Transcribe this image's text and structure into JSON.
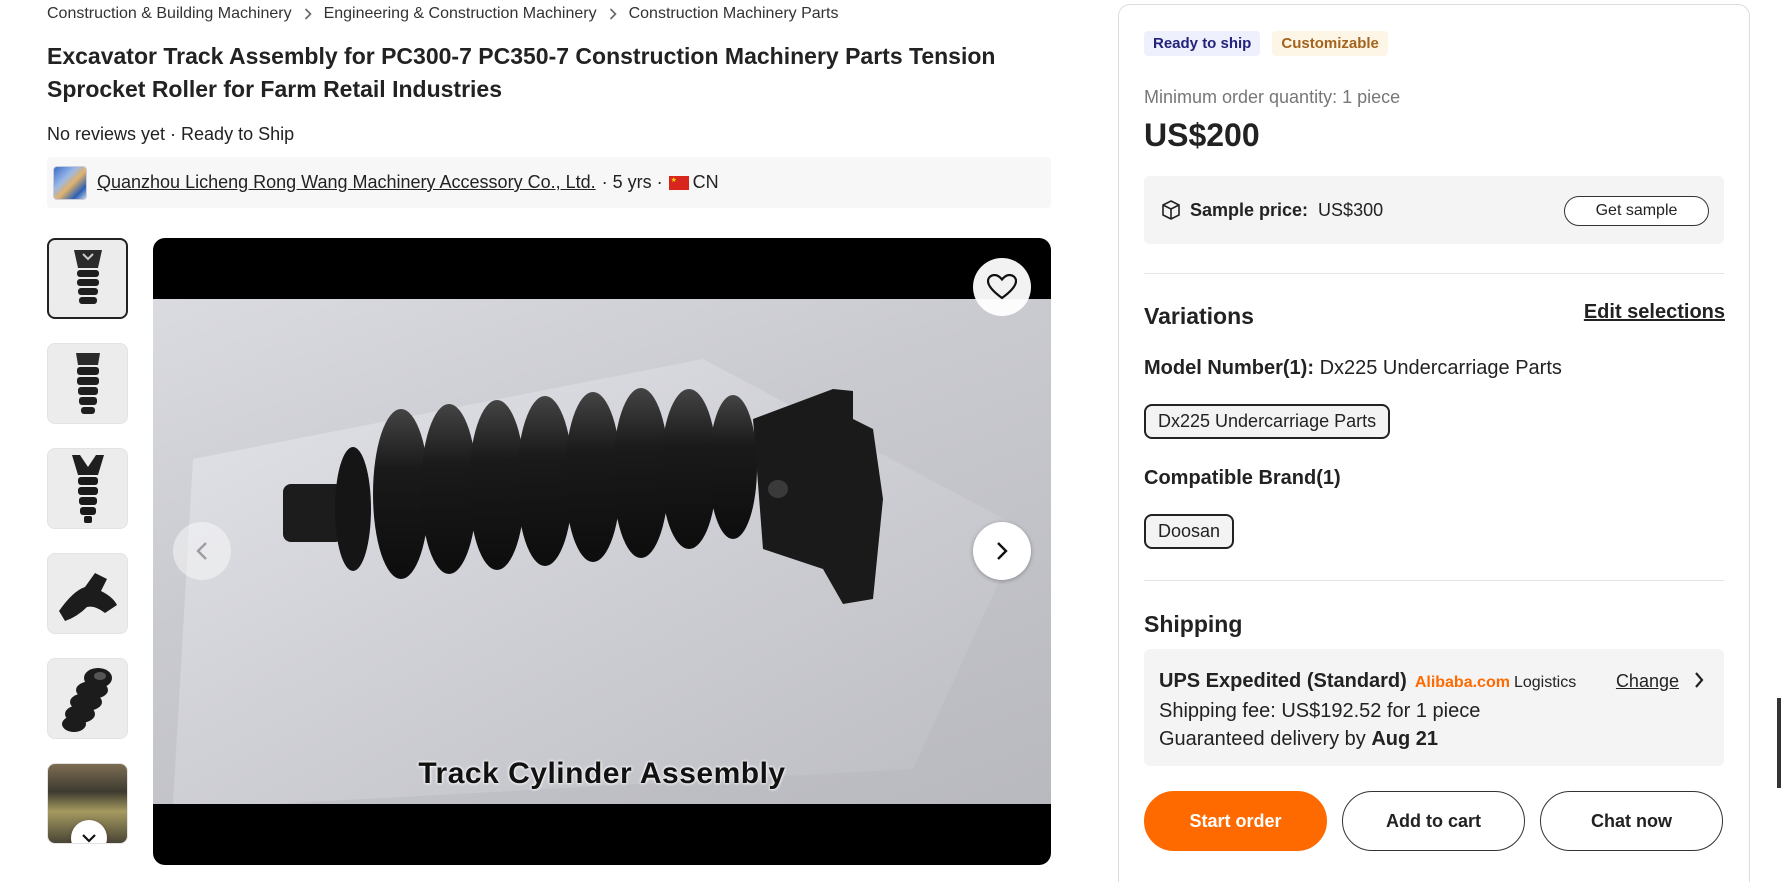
{
  "breadcrumb": {
    "items": [
      "Construction & Building Machinery",
      "Engineering & Construction Machinery",
      "Construction Machinery Parts"
    ]
  },
  "product": {
    "title": "Excavator Track Assembly for PC300-7 PC350-7 Construction Machinery Parts Tension Sprocket Roller for Farm Retail Industries",
    "reviews_status": "No reviews yet · Ready to Ship",
    "image_caption": "Track Cylinder Assembly"
  },
  "supplier": {
    "name": "Quanzhou Licheng Rong Wang Machinery Accessory Co., Ltd.",
    "years": "· 5 yrs ·",
    "country": "CN"
  },
  "icons": {
    "favorite": "heart-icon",
    "prev": "chevron-left-icon",
    "next": "chevron-right-icon",
    "thumbs_down": "chevron-down-icon",
    "sample": "box-icon"
  },
  "panel": {
    "badges": [
      "Ready to ship",
      "Customizable"
    ],
    "moq": "Minimum order quantity: 1 piece",
    "price": "US$200",
    "sample_label": "Sample price:",
    "sample_price": "US$300",
    "get_sample": "Get sample",
    "variations_title": "Variations",
    "edit_selections": "Edit selections",
    "model_label": "Model Number(1):",
    "model_value": "Dx225 Undercarriage Parts",
    "model_option": "Dx225 Undercarriage Parts",
    "brand_label": "Compatible Brand(1)",
    "brand_option": "Doosan",
    "shipping_title": "Shipping",
    "ship_method": "UPS Expedited (Standard)",
    "ship_brand": "Alibaba.com",
    "ship_logistics": "Logistics",
    "ship_change": "Change",
    "ship_fee": "Shipping fee: US$192.52 for 1 piece",
    "ship_delivery_prefix": "Guaranteed delivery by",
    "ship_delivery_date": "Aug 21",
    "btn_start": "Start order",
    "btn_cart": "Add to cart",
    "btn_chat": "Chat now"
  },
  "colors": {
    "accent": "#ff6a00",
    "ready_badge_bg": "#eef0fd",
    "custom_badge_text": "#a4631e"
  }
}
